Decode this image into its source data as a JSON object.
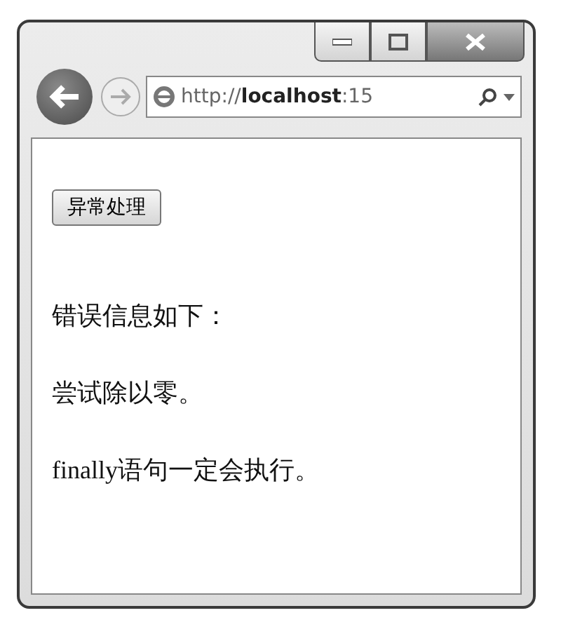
{
  "address_bar": {
    "url": "http://**localhost**:15"
  },
  "content": {
    "button": "异常处理",
    "lines": [
      "错误信息如下：",
      "尝试除以零。",
      "finally语句一定会执行。"
    ]
  }
}
